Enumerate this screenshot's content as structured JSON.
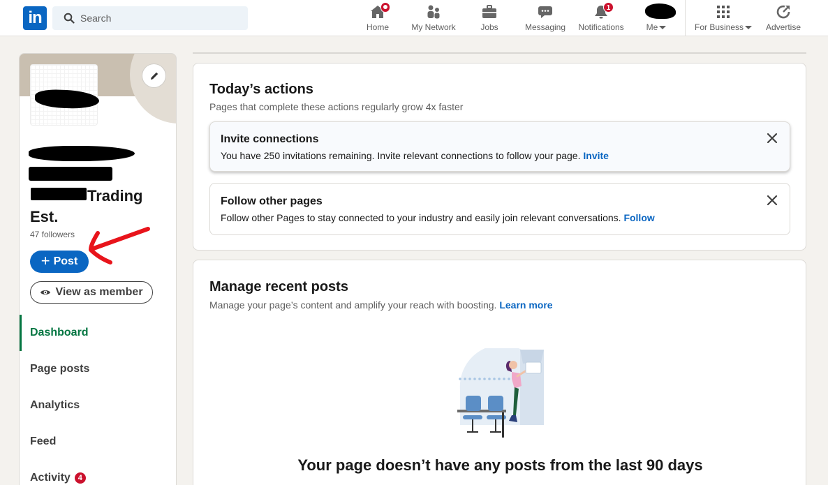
{
  "nav": {
    "logo": "in",
    "search_placeholder": "Search",
    "items": [
      {
        "label": "Home",
        "badge": ""
      },
      {
        "label": "My Network",
        "badge": ""
      },
      {
        "label": "Jobs",
        "badge": ""
      },
      {
        "label": "Messaging",
        "badge": ""
      },
      {
        "label": "Notifications",
        "badge": "1"
      },
      {
        "label": "Me",
        "badge": ""
      },
      {
        "label": "For Business",
        "badge": ""
      },
      {
        "label": "Advertise",
        "badge": ""
      }
    ]
  },
  "sidebar": {
    "org_name_line1": "Trading",
    "org_name_line2": "Est.",
    "followers": "47 followers",
    "post_button": "Post",
    "view_button": "View as member",
    "items": [
      {
        "label": "Dashboard",
        "count": ""
      },
      {
        "label": "Page posts",
        "count": ""
      },
      {
        "label": "Analytics",
        "count": ""
      },
      {
        "label": "Feed",
        "count": ""
      },
      {
        "label": "Activity",
        "count": "4"
      }
    ]
  },
  "today": {
    "title": "Today’s actions",
    "subtitle": "Pages that complete these actions regularly grow 4x faster",
    "actions": [
      {
        "title": "Invite connections",
        "desc": "You have 250 invitations remaining. Invite relevant connections to follow your page.",
        "link": "Invite"
      },
      {
        "title": "Follow other pages",
        "desc": "Follow other Pages to stay connected to your industry and easily join relevant conversations.",
        "link": "Follow"
      }
    ]
  },
  "recent": {
    "title": "Manage recent posts",
    "subtitle": "Manage your page’s content and amplify your reach with boosting.",
    "link": "Learn more",
    "empty_text": "Your page doesn’t have any posts from the last 90 days"
  },
  "colors": {
    "brand": "#0a66c2",
    "active": "#057642",
    "badge": "#cb112d",
    "annotation": "#e8141b"
  }
}
